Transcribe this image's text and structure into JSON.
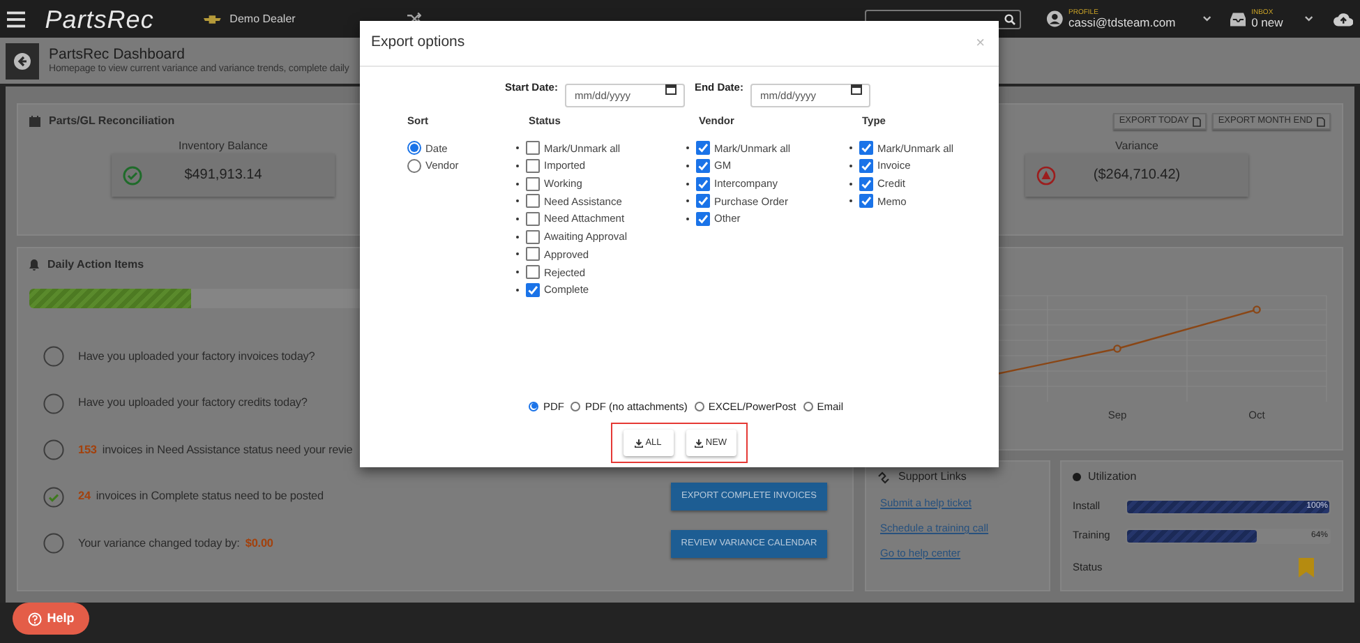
{
  "header": {
    "logo": "PartsRec",
    "dealer": "Demo Dealer",
    "profile": {
      "label": "PROFILE",
      "email": "cassi@tdsteam.com"
    },
    "inbox": {
      "label": "INBOX",
      "count": "0 new"
    }
  },
  "page": {
    "title": "PartsRec Dashboard",
    "subtitle": "Homepage to view current variance and variance trends, complete daily"
  },
  "reconciliation": {
    "title": "Parts/GL Reconciliation",
    "buttons": [
      "EXPORT TODAY",
      "EXPORT MONTH END"
    ],
    "stats": [
      {
        "label": "Inventory Balance",
        "value": "$491,913.14",
        "kind": "ok"
      },
      {
        "label": "Variance",
        "value": "($264,710.42)",
        "kind": "alert"
      }
    ]
  },
  "daily_actions": {
    "title": "Daily Action Items",
    "level": 0.2,
    "items": [
      {
        "checked": false,
        "parts": [
          {
            "kind": "plain",
            "text": "Have you uploaded your factory invoices today?"
          }
        ]
      },
      {
        "checked": false,
        "parts": [
          {
            "kind": "plain",
            "text": "Have you uploaded your factory credits today?"
          }
        ]
      },
      {
        "checked": false,
        "parts": [
          {
            "kind": "count",
            "text": "153"
          },
          {
            "kind": "plain",
            "text": "invoices in Need Assistance status need your revie"
          }
        ]
      },
      {
        "checked": true,
        "parts": [
          {
            "kind": "count",
            "text": "24"
          },
          {
            "kind": "plain",
            "text": "invoices in Complete status need to be posted"
          }
        ],
        "button": "EXPORT COMPLETE INVOICES"
      },
      {
        "checked": false,
        "parts": [
          {
            "kind": "plain",
            "text": "Your variance changed today by:"
          },
          {
            "kind": "count",
            "text": "$0.00"
          }
        ],
        "button": "REVIEW VARIANCE CALENDAR"
      }
    ]
  },
  "chart": {
    "x_labels": [
      "Sep",
      "Oct"
    ]
  },
  "support": {
    "title": "Support Links",
    "links": [
      "Submit a help ticket",
      "Schedule a training call",
      "Go to help center"
    ]
  },
  "utilization": {
    "title": "Utilization",
    "meters": [
      {
        "label": "Install",
        "level": 1,
        "reading": "100%"
      },
      {
        "label": "Training",
        "level": 0.64,
        "reading": "64%"
      }
    ],
    "status_label": "Status"
  },
  "help": "Help",
  "modal": {
    "title": "Export options",
    "close": "×",
    "dates": [
      {
        "label": "Start Date:",
        "placeholder": "mm/dd/yyyy"
      },
      {
        "label": "End Date:",
        "placeholder": "mm/dd/yyyy"
      }
    ],
    "columns": [
      {
        "title": "Sort",
        "kind": "radio",
        "options": [
          {
            "label": "Date",
            "selected": true
          },
          {
            "label": "Vendor",
            "selected": false
          }
        ]
      },
      {
        "title": "Status",
        "kind": "checkbox",
        "options": [
          {
            "label": "Mark/Unmark all",
            "checked": false
          },
          {
            "label": "Imported",
            "checked": false
          },
          {
            "label": "Working",
            "checked": false
          },
          {
            "label": "Need Assistance",
            "checked": false
          },
          {
            "label": "Need Attachment",
            "checked": false
          },
          {
            "label": "Awaiting Approval",
            "checked": false
          },
          {
            "label": "Approved",
            "checked": false
          },
          {
            "label": "Rejected",
            "checked": false
          },
          {
            "label": "Complete",
            "checked": true
          }
        ]
      },
      {
        "title": "Vendor",
        "kind": "checkbox",
        "options": [
          {
            "label": "Mark/Unmark all",
            "checked": true
          },
          {
            "label": "GM",
            "checked": true
          },
          {
            "label": "Intercompany",
            "checked": true
          },
          {
            "label": "Purchase Order",
            "checked": true
          },
          {
            "label": "Other",
            "checked": true
          }
        ]
      },
      {
        "title": "Type",
        "kind": "checkbox",
        "options": [
          {
            "label": "Mark/Unmark all",
            "checked": true
          },
          {
            "label": "Invoice",
            "checked": true
          },
          {
            "label": "Credit",
            "checked": true
          },
          {
            "label": "Memo",
            "checked": true
          }
        ]
      }
    ],
    "formats": [
      {
        "label": "PDF",
        "selected": true
      },
      {
        "label": "PDF (no attachments)",
        "selected": false
      },
      {
        "label": "EXCEL/PowerPost",
        "selected": false
      },
      {
        "label": "Email",
        "selected": false
      }
    ],
    "actions": [
      "ALL",
      "NEW"
    ]
  }
}
